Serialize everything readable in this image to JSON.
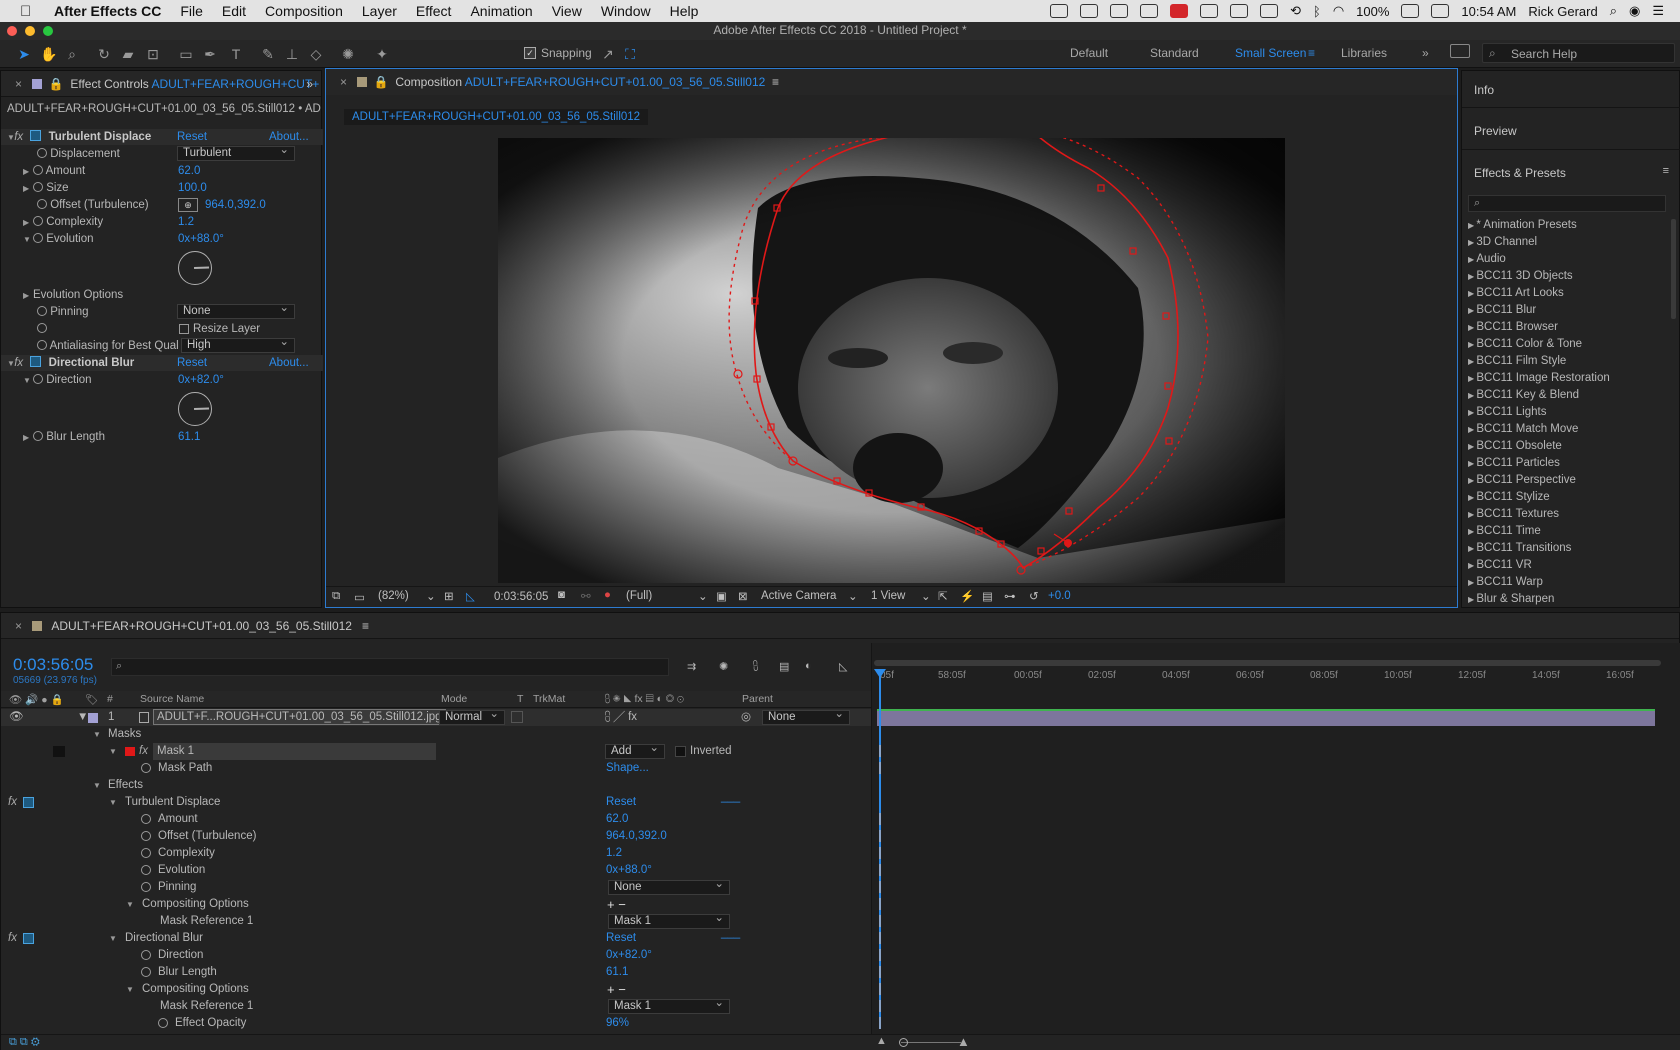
{
  "menubar": {
    "app": "After Effects CC",
    "items": [
      "File",
      "Edit",
      "Composition",
      "Layer",
      "Effect",
      "Animation",
      "View",
      "Window",
      "Help"
    ],
    "battery": "100%",
    "time": "10:54 AM",
    "user": "Rick Gerard"
  },
  "window": {
    "title": "Adobe After Effects CC 2018 - Untitled Project *"
  },
  "toolbar": {
    "snapping": "Snapping",
    "workspaces": [
      "Default",
      "Standard",
      "Small Screen",
      "Libraries"
    ],
    "active_workspace": "Small Screen",
    "search_placeholder": "Search Help"
  },
  "effect_controls": {
    "tab_prefix": "Effect Controls",
    "tab_layer": "ADULT+FEAR+ROUGH+CUT+",
    "subtitle": "ADULT+FEAR+ROUGH+CUT+01.00_03_56_05.Still012 • ADULT+",
    "turbulent": {
      "name": "Turbulent Displace",
      "reset": "Reset",
      "about": "About...",
      "displacement_label": "Displacement",
      "displacement_value": "Turbulent",
      "amount_label": "Amount",
      "amount": "62.0",
      "size_label": "Size",
      "size": "100.0",
      "offset_label": "Offset (Turbulence)",
      "offset": "964.0,392.0",
      "complexity_label": "Complexity",
      "complexity": "1.2",
      "evolution_label": "Evolution",
      "evolution": "0x+88.0°",
      "evo_options": "Evolution Options",
      "pinning_label": "Pinning",
      "pinning": "None",
      "resize_layer": "Resize Layer",
      "antialias_label": "Antialiasing for Best Qual",
      "antialias": "High"
    },
    "directional": {
      "name": "Directional Blur",
      "reset": "Reset",
      "about": "About...",
      "direction_label": "Direction",
      "direction": "0x+82.0°",
      "blur_label": "Blur Length",
      "blur": "61.1"
    }
  },
  "composition": {
    "tab_prefix": "Composition",
    "tab_name": "ADULT+FEAR+ROUGH+CUT+01.00_03_56_05.Still012",
    "layer_chip": "ADULT+FEAR+ROUGH+CUT+01.00_03_56_05.Still012",
    "footer": {
      "zoom": "(82%)",
      "timecode": "0:03:56:05",
      "resolution": "(Full)",
      "camera": "Active Camera",
      "views": "1 View",
      "exposure": "+0.0"
    }
  },
  "right_panel": {
    "info": "Info",
    "preview": "Preview",
    "effects_presets": "Effects & Presets",
    "search_placeholder": "",
    "items": [
      "* Animation Presets",
      "3D Channel",
      "Audio",
      "BCC11 3D Objects",
      "BCC11 Art Looks",
      "BCC11 Blur",
      "BCC11 Browser",
      "BCC11 Color & Tone",
      "BCC11 Film Style",
      "BCC11 Image Restoration",
      "BCC11 Key & Blend",
      "BCC11 Lights",
      "BCC11 Match Move",
      "BCC11 Obsolete",
      "BCC11 Particles",
      "BCC11 Perspective",
      "BCC11 Stylize",
      "BCC11 Textures",
      "BCC11 Time",
      "BCC11 Transitions",
      "BCC11 VR",
      "BCC11 Warp",
      "Blur & Sharpen"
    ]
  },
  "timeline": {
    "tab": "ADULT+FEAR+ROUGH+CUT+01.00_03_56_05.Still012",
    "timecode": "0:03:56:05",
    "frames": "05669 (23.976 fps)",
    "headers": {
      "num": "#",
      "source": "Source Name",
      "mode": "Mode",
      "t": "T",
      "trkmat": "TrkMat",
      "parent": "Parent"
    },
    "ruler": [
      "05f",
      "58:05f",
      "00:05f",
      "02:05f",
      "04:05f",
      "06:05f",
      "08:05f",
      "10:05f",
      "12:05f",
      "14:05f",
      "16:05f"
    ],
    "layer": {
      "num": "1",
      "name": "ADULT+F...ROUGH+CUT+01.00_03_56_05.Still012.jpg",
      "mode": "Normal",
      "parent": "None"
    },
    "masks": "Masks",
    "mask1": "Mask 1",
    "mask_mode": "Add",
    "inverted": "Inverted",
    "mask_path": "Mask Path",
    "shape": "Shape...",
    "effects": "Effects",
    "td": "Turbulent Displace",
    "reset": "Reset",
    "dash": "___",
    "amount_label": "Amount",
    "amount": "62.0",
    "offset_label": "Offset (Turbulence)",
    "offset": "964.0,392.0",
    "complexity_label": "Complexity",
    "complexity": "1.2",
    "evolution_label": "Evolution",
    "evolution": "0x+88.0°",
    "pinning_label": "Pinning",
    "pinning": "None",
    "compositing": "Compositing Options",
    "plusminus": "+ −",
    "mask_ref": "Mask Reference 1",
    "mask_ref_val": "Mask 1",
    "db": "Directional Blur",
    "direction_label": "Direction",
    "direction": "0x+82.0°",
    "blur_label": "Blur Length",
    "blur": "61.1",
    "opacity_label": "Effect Opacity",
    "opacity": "96%"
  }
}
